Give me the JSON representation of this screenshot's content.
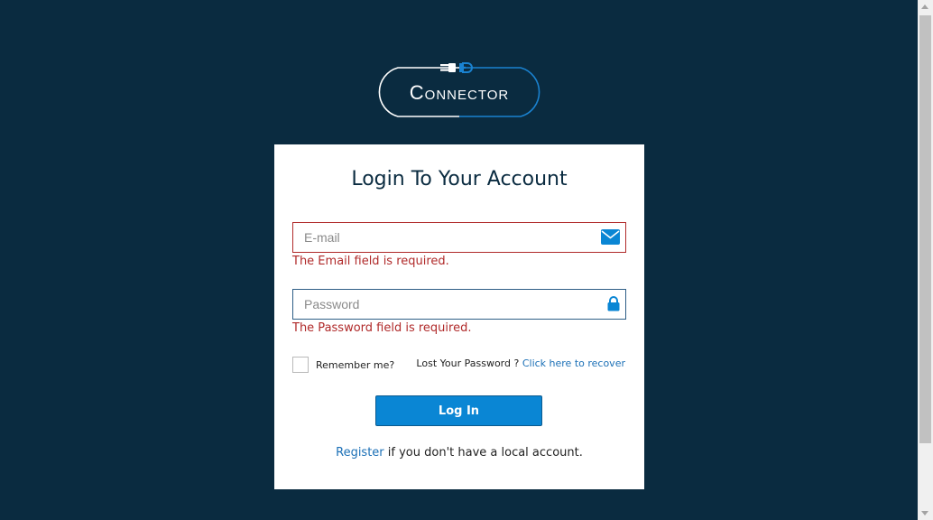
{
  "logo": {
    "text": "Connector",
    "color_white": "#ffffff",
    "color_blue": "#1a82d0"
  },
  "login": {
    "title": "Login To Your Account",
    "email": {
      "placeholder": "E-mail",
      "value": "",
      "error": "The Email field is required."
    },
    "password": {
      "placeholder": "Password",
      "value": "",
      "error": "The Password field is required."
    },
    "remember_label": "Remember me?",
    "lost_password_text": "Lost Your Password ?",
    "recover_link": "Click here to recover",
    "login_button": "Log In",
    "register_link": "Register",
    "register_suffix": " if you don't have a local account."
  },
  "colors": {
    "background": "#0a2b40",
    "error": "#b02a2a",
    "button": "#0a86d4",
    "link": "#1a6fb6"
  }
}
